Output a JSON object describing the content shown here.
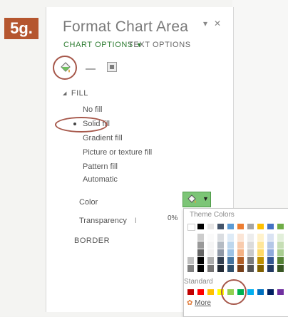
{
  "step": "5g.",
  "pane": {
    "title": "Format Chart Area",
    "tabs": {
      "chart_options": "CHART OPTIONS",
      "text_options": "TEXT OPTIONS"
    },
    "fill_section": "FILL",
    "fill_options": [
      "No fill",
      "Solid fill",
      "Gradient fill",
      "Picture or texture fill",
      "Pattern fill",
      "Automatic"
    ],
    "selected_fill": "Solid fill",
    "color_label": "Color",
    "transparency_label": "Transparency",
    "transparency_value": "0%",
    "border_section": "BORDER",
    "current_color": "#7cc576"
  },
  "palette": {
    "theme_label": "Theme Colors",
    "standard_label": "Standard",
    "more_label": "More",
    "theme_colors": [
      "#ffffff",
      "#000000",
      "#e7e6e6",
      "#44546a",
      "#5b9bd5",
      "#ed7d31",
      "#a5a5a5",
      "#ffc000",
      "#4472c4",
      "#70ad47"
    ],
    "standard_colors": [
      "#c00000",
      "#ff0000",
      "#ffc000",
      "#ffff00",
      "#92d050",
      "#00b050",
      "#00b0f0",
      "#0070c0",
      "#002060",
      "#7030a0"
    ],
    "selected_standard": "#92d050"
  }
}
